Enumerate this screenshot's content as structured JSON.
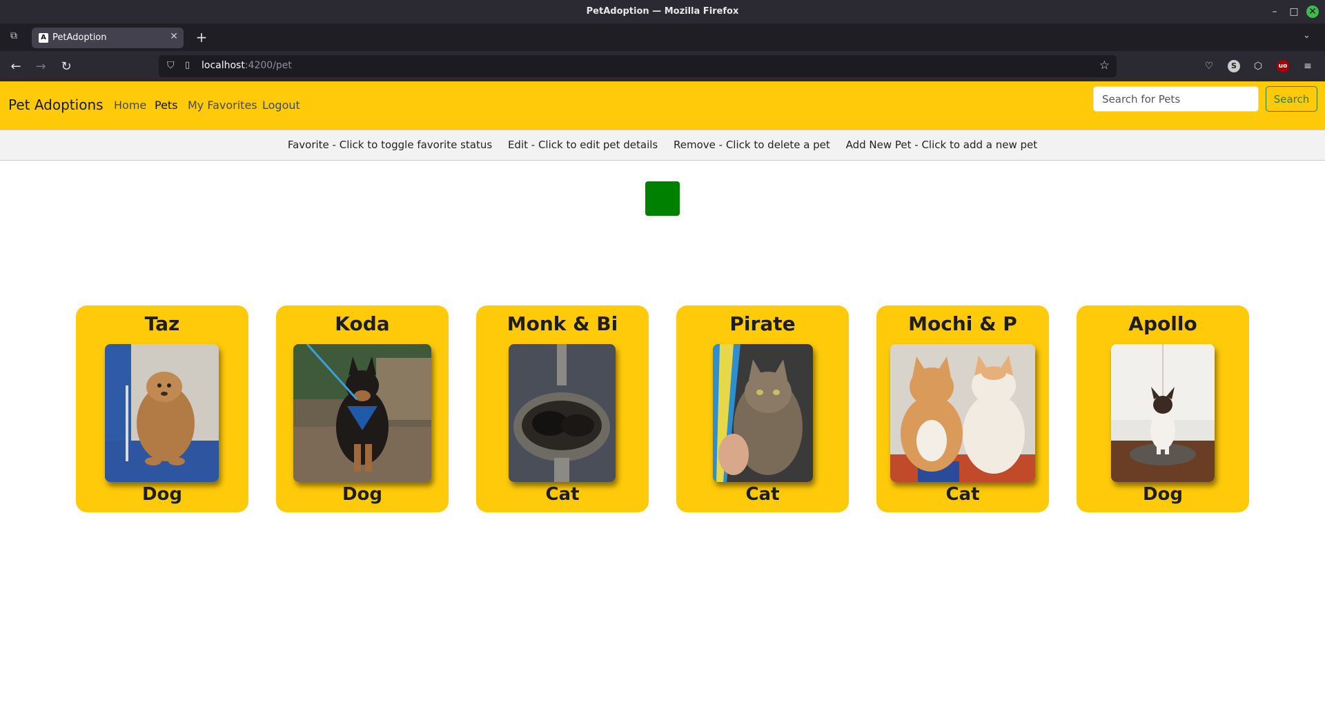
{
  "window": {
    "title": "PetAdoption — Mozilla Firefox",
    "min_glyph": "–",
    "max_glyph": "□",
    "close_glyph": "✕"
  },
  "browser": {
    "tab_list_glyph": "⧉",
    "tab_title": "PetAdoption",
    "tab_favicon": "A",
    "tab_close_glyph": "✕",
    "new_tab_glyph": "+",
    "overflow_glyph": "⌄",
    "back_glyph": "←",
    "forward_glyph": "→",
    "reload_glyph": "↻",
    "url_host": "localhost",
    "url_path": ":4200/pet",
    "bookmark_glyph": "☆",
    "toolbar": {
      "pocket": "♡",
      "account": "S",
      "extensions": "⬡",
      "ublock": "uo",
      "menu": "≡"
    }
  },
  "app_nav": {
    "brand": "Pet Adoptions",
    "links": [
      "Home",
      "Pets",
      "My Favorites",
      "Logout"
    ],
    "search_placeholder": "Search for Pets",
    "search_button": "Search"
  },
  "help": {
    "items": [
      "Favorite - Click to toggle favorite status",
      "Edit - Click to edit pet details",
      "Remove - Click to delete a pet",
      "Add New Pet - Click to add a new pet"
    ]
  },
  "pets": [
    {
      "name": "Taz",
      "type": "Dog"
    },
    {
      "name": "Koda",
      "type": "Dog"
    },
    {
      "name": "Monk & Bi",
      "type": "Cat"
    },
    {
      "name": "Pirate",
      "type": "Cat"
    },
    {
      "name": "Mochi & P",
      "type": "Cat"
    },
    {
      "name": "Apollo",
      "type": "Dog"
    }
  ],
  "colors": {
    "nav_yellow": "#ffca0a",
    "status_green": "#008000"
  }
}
